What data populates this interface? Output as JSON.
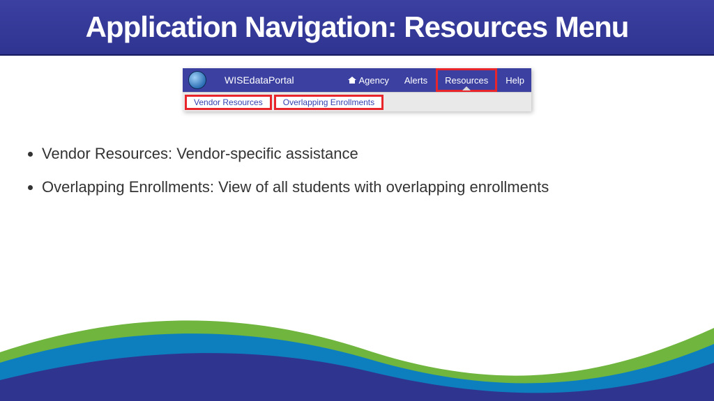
{
  "slide": {
    "title": "Application Navigation: Resources Menu"
  },
  "app": {
    "portal_name": "WISEdataPortal",
    "nav": {
      "agency": "Agency",
      "alerts": "Alerts",
      "resources": "Resources",
      "help": "Help"
    },
    "submenu": {
      "vendor": "Vendor Resources",
      "overlap": "Overlapping Enrollments"
    }
  },
  "bullets": {
    "b1": "Vendor Resources: Vendor-specific assistance",
    "b2": "Overlapping Enrollments: View of all students with overlapping enrollments"
  }
}
